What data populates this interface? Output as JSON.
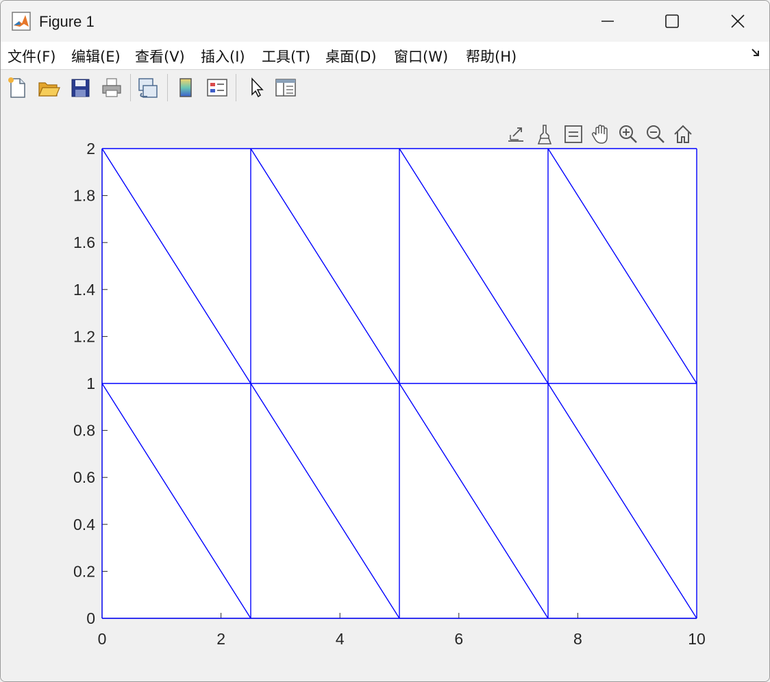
{
  "window": {
    "title": "Figure 1",
    "icons": [
      "matlab-logo-icon",
      "minimize-icon",
      "maximize-icon",
      "close-icon"
    ]
  },
  "menu": {
    "items": [
      {
        "label": "文件(F)"
      },
      {
        "label": "编辑(E)"
      },
      {
        "label": "查看(V)"
      },
      {
        "label": "插入(I)"
      },
      {
        "label": "工具(T)"
      },
      {
        "label": "桌面(D)"
      },
      {
        "label": "窗口(W)"
      },
      {
        "label": "帮助(H)"
      }
    ],
    "overflow_icon": "dock-arrow-icon"
  },
  "toolbar": {
    "buttons": [
      "new-figure-icon",
      "open-file-icon",
      "save-icon",
      "print-icon",
      "link-plot-icon",
      "colorbar-icon",
      "legend-icon",
      "edit-plot-pointer-icon",
      "property-inspector-icon"
    ]
  },
  "axes_toolbar": {
    "buttons": [
      "export-icon",
      "brush-icon",
      "data-tips-icon",
      "pan-icon",
      "zoom-in-icon",
      "zoom-out-icon",
      "restore-view-icon"
    ]
  },
  "chart_data": {
    "type": "line",
    "title": "",
    "xlabel": "",
    "ylabel": "",
    "xlim": [
      0,
      10
    ],
    "ylim": [
      0,
      2
    ],
    "xticks": [
      0,
      2,
      4,
      6,
      8,
      10
    ],
    "yticks": [
      0,
      0.2,
      0.4,
      0.6,
      0.8,
      1,
      1.2,
      1.4,
      1.6,
      1.8,
      2
    ],
    "xtick_labels": [
      "0",
      "2",
      "4",
      "6",
      "8",
      "10"
    ],
    "ytick_labels": [
      "0",
      "0.2",
      "0.4",
      "0.6",
      "0.8",
      "1",
      "1.2",
      "1.4",
      "1.6",
      "1.8",
      "2"
    ],
    "grid": false,
    "line_color": "#0000ff",
    "segments": [
      {
        "x": [
          0,
          10
        ],
        "y": [
          0,
          0
        ]
      },
      {
        "x": [
          0,
          10
        ],
        "y": [
          1,
          1
        ]
      },
      {
        "x": [
          0,
          10
        ],
        "y": [
          2,
          2
        ]
      },
      {
        "x": [
          0,
          0
        ],
        "y": [
          0,
          2
        ]
      },
      {
        "x": [
          2.5,
          2.5
        ],
        "y": [
          0,
          2
        ]
      },
      {
        "x": [
          5,
          5
        ],
        "y": [
          0,
          2
        ]
      },
      {
        "x": [
          7.5,
          7.5
        ],
        "y": [
          0,
          2
        ]
      },
      {
        "x": [
          10,
          10
        ],
        "y": [
          0,
          2
        ]
      },
      {
        "x": [
          0,
          2.5
        ],
        "y": [
          1,
          0
        ]
      },
      {
        "x": [
          2.5,
          5
        ],
        "y": [
          1,
          0
        ]
      },
      {
        "x": [
          5,
          7.5
        ],
        "y": [
          1,
          0
        ]
      },
      {
        "x": [
          7.5,
          10
        ],
        "y": [
          1,
          0
        ]
      },
      {
        "x": [
          0,
          2.5
        ],
        "y": [
          2,
          1
        ]
      },
      {
        "x": [
          2.5,
          5
        ],
        "y": [
          2,
          1
        ]
      },
      {
        "x": [
          5,
          7.5
        ],
        "y": [
          2,
          1
        ]
      },
      {
        "x": [
          7.5,
          10
        ],
        "y": [
          2,
          1
        ]
      }
    ]
  }
}
